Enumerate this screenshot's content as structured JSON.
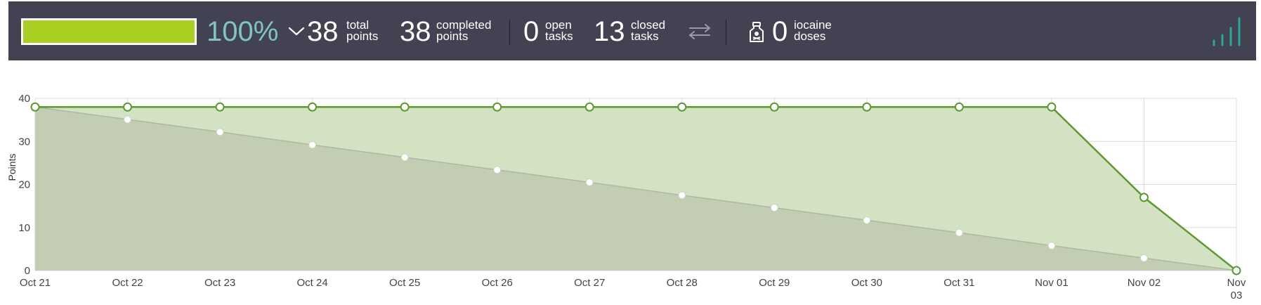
{
  "summary": {
    "progress_fraction": 1.0,
    "percent_text": "100%",
    "total_points": {
      "value": "38",
      "label1": "total",
      "label2": "points"
    },
    "completed_points": {
      "value": "38",
      "label1": "completed",
      "label2": "points"
    },
    "open_tasks": {
      "value": "0",
      "label1": "open",
      "label2": "tasks"
    },
    "closed_tasks": {
      "value": "13",
      "label1": "closed",
      "label2": "tasks"
    },
    "iocaine_doses": {
      "value": "0",
      "label1": "iocaine",
      "label2": "doses"
    },
    "icons": {
      "toggle": "chevron-down-icon",
      "swap": "swap-arrows-icon",
      "iocaine": "poison-bottle-icon",
      "stats": "signal-bars-icon"
    }
  },
  "colors": {
    "header_bg": "#424253",
    "progress_fill": "#a8ce22",
    "percent_text": "#7fc6bd",
    "signal_icon": "#2aa89a",
    "actual_line": "#5c9a2e",
    "actual_fill": "#d1e0c0",
    "ideal_line": "#adb8a4",
    "ideal_fill": "#bfc9b2",
    "ideal_point": "#ffffff"
  },
  "chart_data": {
    "type": "area",
    "ylabel": "Points",
    "ylim": [
      0,
      40
    ],
    "y_ticks": [
      0,
      10,
      20,
      30,
      40
    ],
    "categories": [
      [
        "Oct 21"
      ],
      [
        "Oct 22"
      ],
      [
        "Oct 23"
      ],
      [
        "Oct 24"
      ],
      [
        "Oct 25"
      ],
      [
        "Oct 26"
      ],
      [
        "Oct 27"
      ],
      [
        "Oct 28"
      ],
      [
        "Oct 29"
      ],
      [
        "Oct 30"
      ],
      [
        "Oct 31"
      ],
      [
        "Nov 01"
      ],
      [
        "Nov 02"
      ],
      [
        "Nov",
        "03"
      ]
    ],
    "grid": true,
    "series": [
      {
        "role": "optimal",
        "values": [
          38,
          35.1,
          32.2,
          29.2,
          26.3,
          23.4,
          20.5,
          17.5,
          14.6,
          11.7,
          8.8,
          5.8,
          2.9,
          0
        ]
      },
      {
        "role": "actual",
        "values": [
          38,
          38,
          38,
          38,
          38,
          38,
          38,
          38,
          38,
          38,
          38,
          38,
          17,
          0
        ]
      }
    ]
  }
}
